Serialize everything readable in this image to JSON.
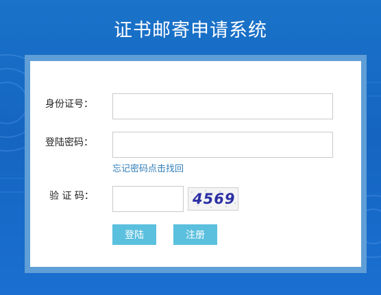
{
  "page": {
    "title": "证书邮寄申请系统"
  },
  "form": {
    "id_label": "身份证号：",
    "id_value": "",
    "password_label": "登陆密码：",
    "password_value": "",
    "forgot_link": "忘记密码点击找回",
    "captcha_label": "验 证 码：",
    "captcha_value": "",
    "captcha_image_text": "4569"
  },
  "buttons": {
    "login": "登陆",
    "register": "注册"
  },
  "colors": {
    "background": "#1565c0",
    "frame": "#5f9ed6",
    "button": "#5bc0de",
    "link": "#2f7db8"
  }
}
